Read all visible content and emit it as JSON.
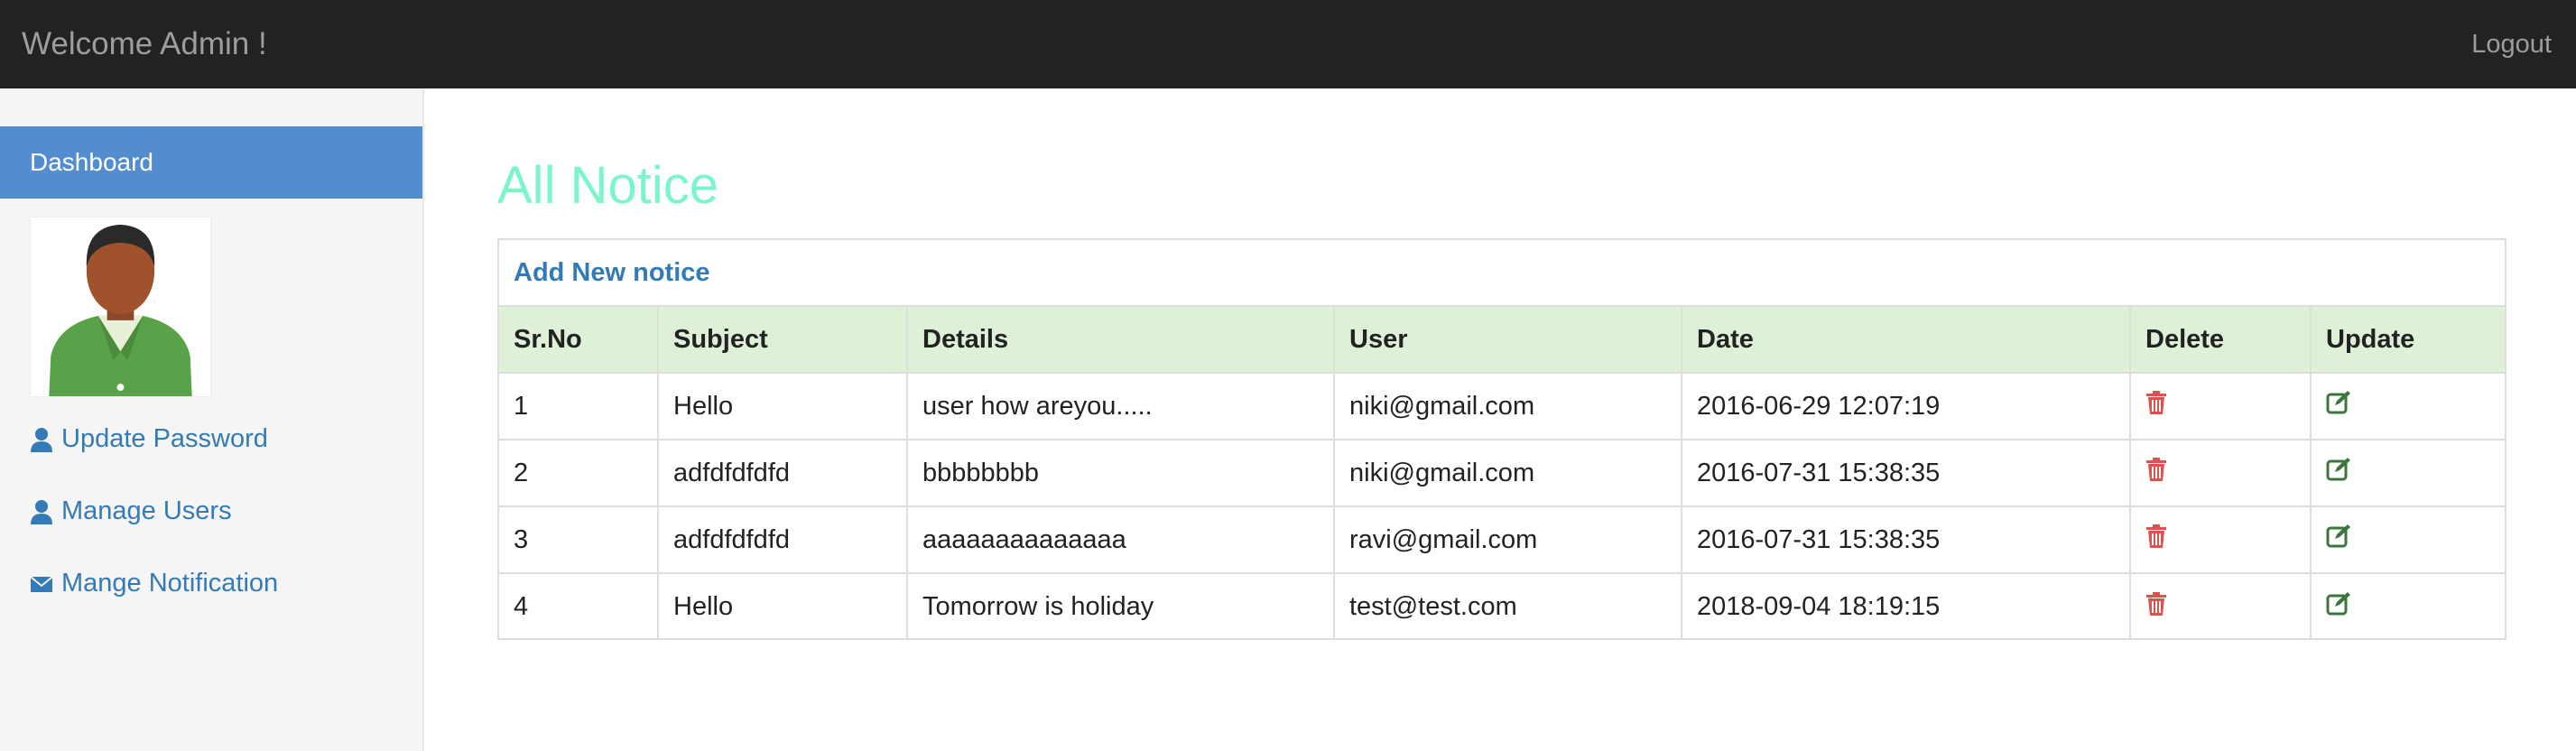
{
  "header": {
    "welcome": "Welcome Admin !",
    "logout": "Logout"
  },
  "sidebar": {
    "dashboard": "Dashboard",
    "avatar_alt": "admin-avatar",
    "links": [
      {
        "label": "Update Password",
        "icon": "user-icon"
      },
      {
        "label": "Manage Users",
        "icon": "user-icon"
      },
      {
        "label": "Mange Notification",
        "icon": "envelope-icon"
      }
    ]
  },
  "main": {
    "title": "All Notice",
    "add_link": "Add New notice",
    "columns": [
      "Sr.No",
      "Subject",
      "Details",
      "User",
      "Date",
      "Delete",
      "Update"
    ],
    "rows": [
      {
        "srno": "1",
        "subject": "Hello",
        "details": "user how areyou.....",
        "user": "niki@gmail.com",
        "date": "2016-06-29 12:07:19"
      },
      {
        "srno": "2",
        "subject": "adfdfdfdfd",
        "details": "bbbbbbbb",
        "user": "niki@gmail.com",
        "date": "2016-07-31 15:38:35"
      },
      {
        "srno": "3",
        "subject": "adfdfdfdfd",
        "details": "aaaaaaaaaaaaaa",
        "user": "ravi@gmail.com",
        "date": "2016-07-31 15:38:35"
      },
      {
        "srno": "4",
        "subject": "Hello",
        "details": "Tomorrow is holiday",
        "user": "test@test.com",
        "date": "2018-09-04 18:19:15"
      }
    ]
  },
  "colors": {
    "topbar": "#222222",
    "active": "#538ccf",
    "title": "#7cf5c9",
    "link": "#337ab7",
    "delete": "#d9534f",
    "update": "#3c763d",
    "table_head": "#dff0d8"
  }
}
